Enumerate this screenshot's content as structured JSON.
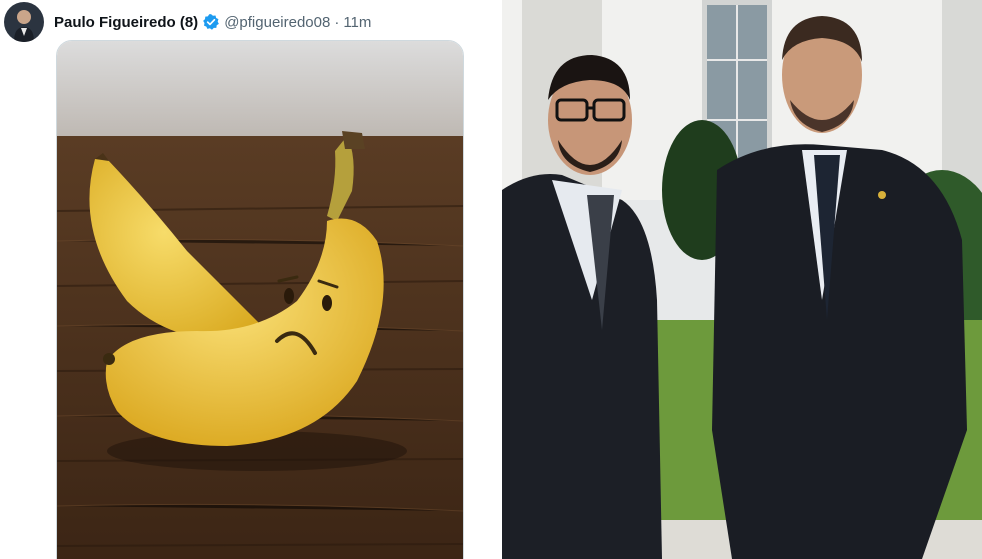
{
  "tweet": {
    "author_name": "Paulo Figueiredo (8)",
    "handle": "@pfigueiredo08",
    "separator": "·",
    "time": "11m",
    "avatar_icon": "avatar-portrait",
    "verified_icon": "verified-badge-icon",
    "verified_color": "#1d9bf0",
    "media": "sad-banana-image"
  },
  "photo": {
    "subject": "two-men-in-suits-photo"
  }
}
